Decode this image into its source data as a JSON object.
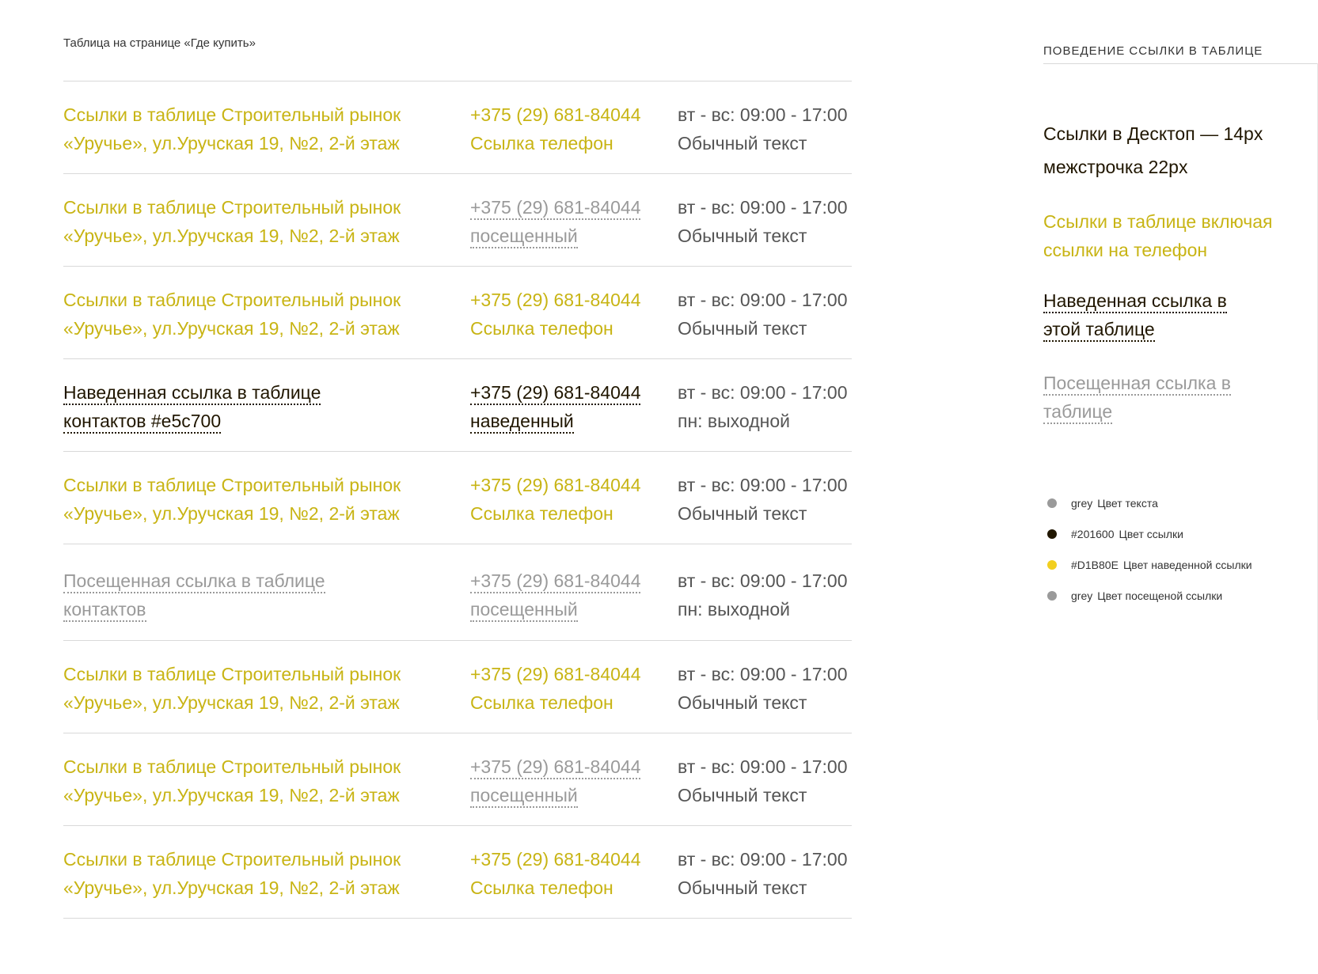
{
  "caption": "Таблица на странице «Где купить»",
  "rows": [
    {
      "addr": {
        "style": "link",
        "lines": [
          "Ссылки в таблице Строительный рынок",
          "«Уручье», ул.Уручская 19, №2, 2-й этаж"
        ]
      },
      "phone": {
        "style": "link",
        "lines": [
          "+375 (29) 681-84044",
          "Ссылка телефон"
        ]
      },
      "hours": {
        "lines": [
          "вт - вс: 09:00 - 17:00",
          "Обычный текст"
        ]
      }
    },
    {
      "addr": {
        "style": "link",
        "lines": [
          "Ссылки в таблице Строительный рынок",
          "«Уручье», ул.Уручская 19, №2, 2-й этаж"
        ]
      },
      "phone": {
        "style": "visited",
        "lines": [
          "+375 (29) 681-84044",
          "посещенный"
        ]
      },
      "hours": {
        "lines": [
          "вт - вс: 09:00 - 17:00",
          "Обычный текст"
        ]
      }
    },
    {
      "addr": {
        "style": "link",
        "lines": [
          "Ссылки в таблице Строительный рынок",
          "«Уручье», ул.Уручская 19, №2, 2-й этаж"
        ]
      },
      "phone": {
        "style": "link",
        "lines": [
          "+375 (29) 681-84044",
          "Ссылка телефон"
        ]
      },
      "hours": {
        "lines": [
          "вт - вс: 09:00 - 17:00",
          "Обычный текст"
        ]
      }
    },
    {
      "addr": {
        "style": "hover",
        "lines": [
          "Наведенная ссылка в таблице",
          "контактов #e5c700"
        ]
      },
      "phone": {
        "style": "hover",
        "lines": [
          "+375 (29) 681-84044",
          "наведенный"
        ]
      },
      "hours": {
        "lines": [
          "вт - вс: 09:00 - 17:00",
          "пн: выходной"
        ]
      }
    },
    {
      "addr": {
        "style": "link",
        "lines": [
          "Ссылки в таблице Строительный рынок",
          "«Уручье», ул.Уручская 19, №2, 2-й этаж"
        ]
      },
      "phone": {
        "style": "link",
        "lines": [
          "+375 (29) 681-84044",
          "Ссылка телефон"
        ]
      },
      "hours": {
        "lines": [
          "вт - вс: 09:00 - 17:00",
          "Обычный текст"
        ]
      }
    },
    {
      "addr": {
        "style": "visited",
        "lines": [
          "Посещенная ссылка в таблице",
          "контактов"
        ]
      },
      "phone": {
        "style": "visited",
        "lines": [
          "+375 (29) 681-84044",
          "посещенный"
        ]
      },
      "hours": {
        "lines": [
          "вт - вс: 09:00 - 17:00",
          "пн: выходной"
        ]
      }
    },
    {
      "addr": {
        "style": "link",
        "lines": [
          "Ссылки в таблице Строительный рынок",
          "«Уручье», ул.Уручская 19, №2, 2-й этаж"
        ]
      },
      "phone": {
        "style": "link",
        "lines": [
          "+375 (29) 681-84044",
          "Ссылка телефон"
        ]
      },
      "hours": {
        "lines": [
          "вт - вс: 09:00 - 17:00",
          "Обычный текст"
        ]
      }
    },
    {
      "addr": {
        "style": "link",
        "lines": [
          "Ссылки в таблице Строительный рынок",
          "«Уручье», ул.Уручская 19, №2, 2-й этаж"
        ]
      },
      "phone": {
        "style": "visited",
        "lines": [
          "+375 (29) 681-84044",
          "посещенный"
        ]
      },
      "hours": {
        "lines": [
          "вт - вс: 09:00 - 17:00",
          "Обычный текст"
        ]
      }
    },
    {
      "addr": {
        "style": "link",
        "lines": [
          "Ссылки в таблице Строительный рынок",
          "«Уручье», ул.Уручская 19, №2, 2-й этаж"
        ]
      },
      "phone": {
        "style": "link",
        "lines": [
          "+375 (29) 681-84044",
          "Ссылка телефон"
        ]
      },
      "hours": {
        "lines": [
          "вт - вс: 09:00 - 17:00",
          "Обычный текст"
        ]
      }
    }
  ],
  "aside": {
    "title": "ПОВЕДЕНИЕ ССЫЛКИ В ТАБЛИЦЕ",
    "size_lines": [
      "Ссылки в Десктоп — 14px",
      "межстрочка 22px"
    ],
    "link_lines": [
      "Ссылки в таблице включая",
      "ссылки на телефон"
    ],
    "hover_lines": [
      "Наведенная ссылка в",
      "этой таблице"
    ],
    "visited_lines": [
      "Посещенная ссылка в",
      "таблице"
    ],
    "legend": [
      {
        "code": "grey",
        "label": "Цвет текста",
        "color": "#9a9a9a"
      },
      {
        "code": "#201600",
        "label": "Цвет ссылки",
        "color": "#201600"
      },
      {
        "code": "#D1B80E",
        "label": "Цвет наведенной ссылки",
        "color": "#f2cf1f"
      },
      {
        "code": "grey",
        "label": "Цвет посещеной ссылки",
        "color": "#9a9a9a"
      }
    ]
  }
}
